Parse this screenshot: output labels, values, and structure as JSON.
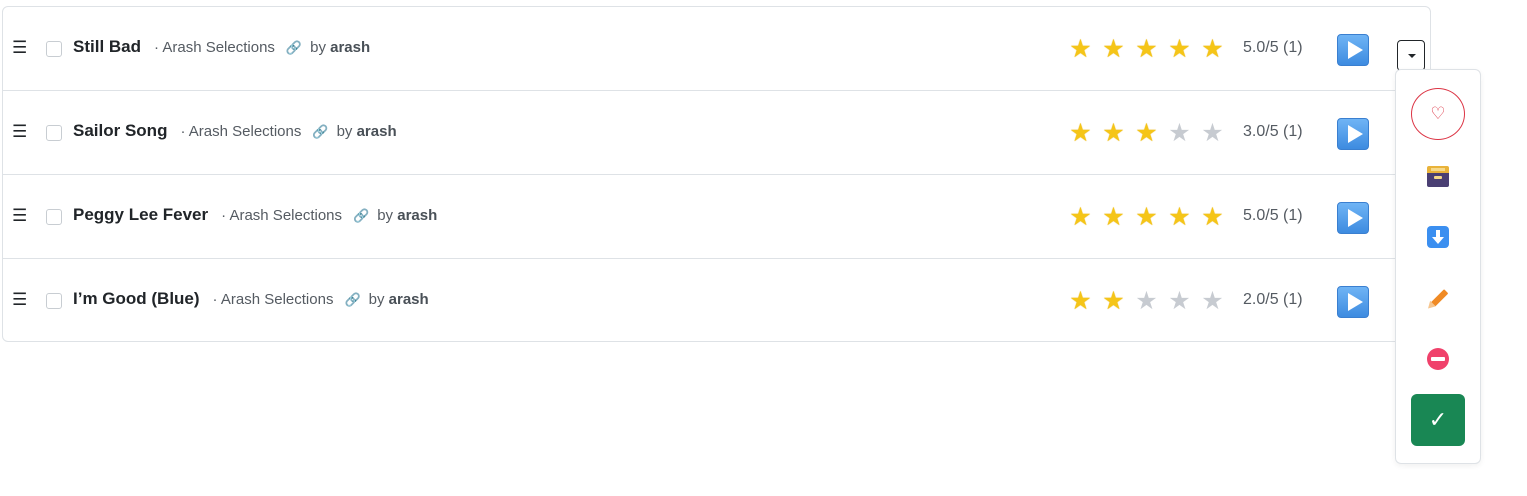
{
  "songs": [
    {
      "title": "Still Bad",
      "collection": "· Arash Selections",
      "by_prefix": "by",
      "author": "arash",
      "rating_text": "5.0/5 (1)",
      "stars": 5
    },
    {
      "title": "Sailor Song",
      "collection": "· Arash Selections",
      "by_prefix": "by",
      "author": "arash",
      "rating_text": "3.0/5 (1)",
      "stars": 3
    },
    {
      "title": "Peggy Lee Fever",
      "collection": "· Arash Selections",
      "by_prefix": "by",
      "author": "arash",
      "rating_text": "5.0/5 (1)",
      "stars": 5
    },
    {
      "title": "I’m Good (Blue)",
      "collection": "· Arash Selections",
      "by_prefix": "by",
      "author": "arash",
      "rating_text": "2.0/5 (1)",
      "stars": 2
    }
  ],
  "icons": {
    "handle": "☰",
    "link": "🔗",
    "star": "★",
    "favorite": "♡",
    "done": "✓"
  },
  "colors": {
    "star_on": "#f5c518",
    "star_off": "#c7cbd1",
    "play": "#3d8be0",
    "favorite": "#dc3545",
    "done": "#198754"
  }
}
